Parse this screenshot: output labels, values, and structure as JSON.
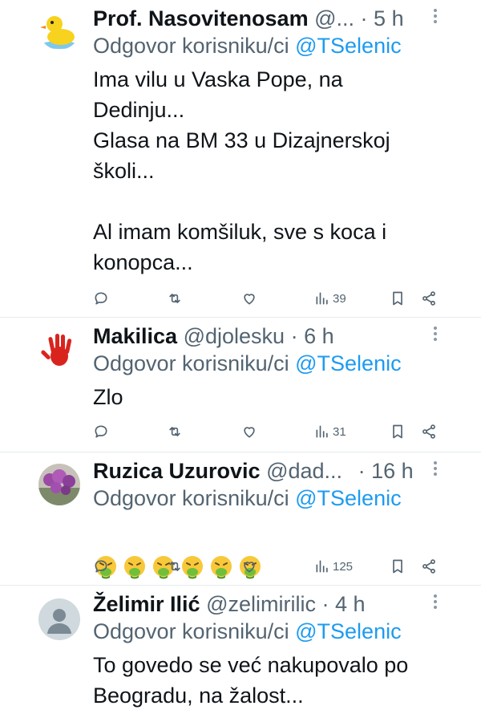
{
  "tweets": [
    {
      "name": "Prof. Nasovitenosam",
      "handle": "@...",
      "dot": "·",
      "time": "5 h",
      "reply_prefix": "Odgovor korisniku/ci",
      "reply_to": "@TSelenic",
      "text": "Ima vilu u Vaska Pope, na\nDedinju...\nGlasa na BM 33 u Dizajnerskoj\nškoli...\n\nAl imam komšiluk, sve s koca i\nkonopca...",
      "views": "39",
      "avatar": "rubber-duck"
    },
    {
      "name": "Makilica",
      "handle": "@djolesku",
      "dot": "·",
      "time": "6 h",
      "reply_prefix": "Odgovor korisniku/ci",
      "reply_to": "@TSelenic",
      "text": "Zlo",
      "views": "31",
      "avatar": "red-handprint"
    },
    {
      "name": "Ruzica Uzurovic",
      "handle": "@dad...",
      "dot": "·",
      "time": "16 h",
      "reply_prefix": "Odgovor korisniku/ci",
      "reply_to": "@TSelenic",
      "emoji": [
        "vomiting-face",
        "vomiting-face",
        "vomiting-face",
        "vomiting-face",
        "vomiting-face",
        "vomiting-face"
      ],
      "views": "125",
      "avatar": "flowers-photo"
    },
    {
      "name": "Želimir Ilić",
      "handle": "@zelimirilic",
      "dot": "·",
      "time": "4 h",
      "reply_prefix": "Odgovor korisniku/ci",
      "reply_to": "@TSelenic",
      "text": "To govedo se već nakupovalo po\nBeogradu, na žalost...",
      "avatar": "default-person"
    }
  ],
  "colors": {
    "link": "#1d9bf0",
    "secondary": "#536471",
    "text": "#0f1419"
  }
}
